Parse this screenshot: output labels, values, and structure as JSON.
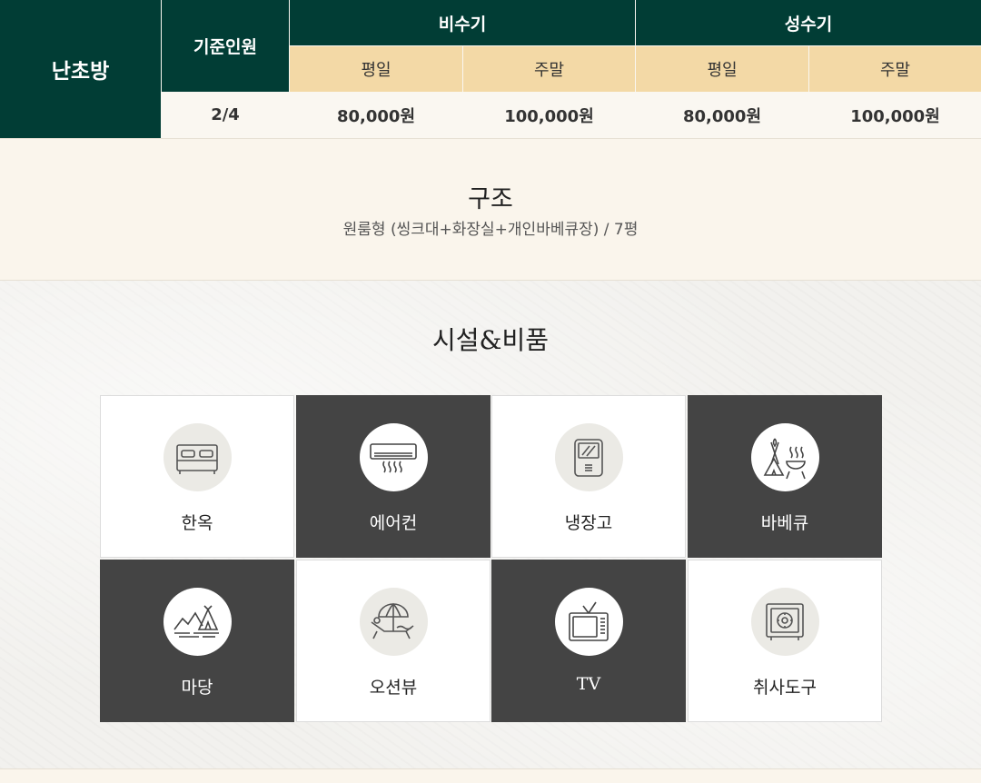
{
  "price_table": {
    "room_name": "난초방",
    "headers": {
      "standard_occupancy": "기준인원",
      "off_season": "비수기",
      "peak_season": "성수기",
      "weekday": "평일",
      "weekend": "주말"
    },
    "values": {
      "occupancy": "2/4",
      "off_weekday": "80,000원",
      "off_weekend": "100,000원",
      "peak_weekday": "80,000원",
      "peak_weekend": "100,000원"
    }
  },
  "structure": {
    "title": "구조",
    "description": "원룸형 (씽크대+화장실+개인바베큐장) / 7평"
  },
  "facilities": {
    "title": "시설&비품",
    "items": [
      {
        "label": "한옥",
        "icon": "bed-icon"
      },
      {
        "label": "에어컨",
        "icon": "air-conditioner-icon"
      },
      {
        "label": "냉장고",
        "icon": "refrigerator-icon"
      },
      {
        "label": "바베큐",
        "icon": "barbecue-icon"
      },
      {
        "label": "마당",
        "icon": "yard-icon"
      },
      {
        "label": "오션뷰",
        "icon": "ocean-view-icon"
      },
      {
        "label": "TV",
        "icon": "tv-icon"
      },
      {
        "label": "취사도구",
        "icon": "safe-icon"
      }
    ]
  },
  "colors": {
    "dark_green": "#013d35",
    "header_gold": "#f3d9a6",
    "dark_tile": "#444444",
    "light_bg": "#faf7f1"
  }
}
